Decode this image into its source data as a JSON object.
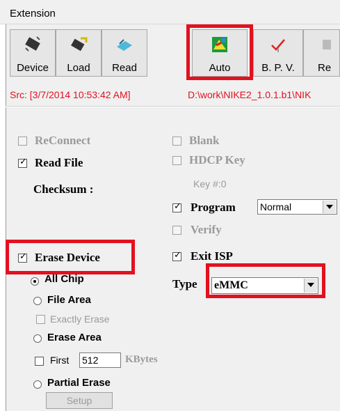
{
  "menubar": {
    "title": "Extension"
  },
  "toolbar": {
    "buttons": [
      {
        "label": "Device",
        "icon": "device-chip-icon"
      },
      {
        "label": "Load",
        "icon": "load-chip-icon"
      },
      {
        "label": "Read",
        "icon": "read-icon"
      },
      {
        "label": "Auto",
        "icon": "auto-icon"
      },
      {
        "label": "B. P. V.",
        "icon": "bpv-check-icon"
      },
      {
        "label": "Re",
        "icon": "reload-icon"
      }
    ]
  },
  "status": {
    "src": "Src: [3/7/2014 10:53:42 AM]",
    "path": "D:\\work\\NIKE2_1.0.1.b1\\NIK"
  },
  "options_left": {
    "reconnect": {
      "label": "ReConnect",
      "checked": false,
      "enabled": false
    },
    "read_file": {
      "label": "Read File",
      "checked": true,
      "enabled": true
    },
    "checksum_label": "Checksum :",
    "erase_device": {
      "label": "Erase Device",
      "checked": true
    },
    "erase_modes": {
      "all_chip": "All Chip",
      "file_area": "File Area",
      "exactly_erase": "Exactly Erase",
      "erase_area": "Erase Area",
      "first_label": "First",
      "first_value": "512",
      "kbytes": "KBytes",
      "partial_erase": "Partial Erase",
      "setup": "Setup",
      "selected": "All Chip"
    }
  },
  "options_right": {
    "blank": {
      "label": "Blank",
      "checked": false,
      "enabled": false
    },
    "hdcp_key": {
      "label": "HDCP Key",
      "checked": false,
      "enabled": false
    },
    "key_no": "Key #:0",
    "program": {
      "label": "Program",
      "checked": true,
      "mode": "Normal"
    },
    "verify": {
      "label": "Verify",
      "checked": false,
      "enabled": false
    },
    "exit_isp": {
      "label": "Exit ISP",
      "checked": true
    },
    "type": {
      "label": "Type",
      "value": "eMMC"
    }
  },
  "colors": {
    "highlight": "#e3101f",
    "status_text": "#e3101f",
    "panel_bg": "#f0f0f0"
  }
}
